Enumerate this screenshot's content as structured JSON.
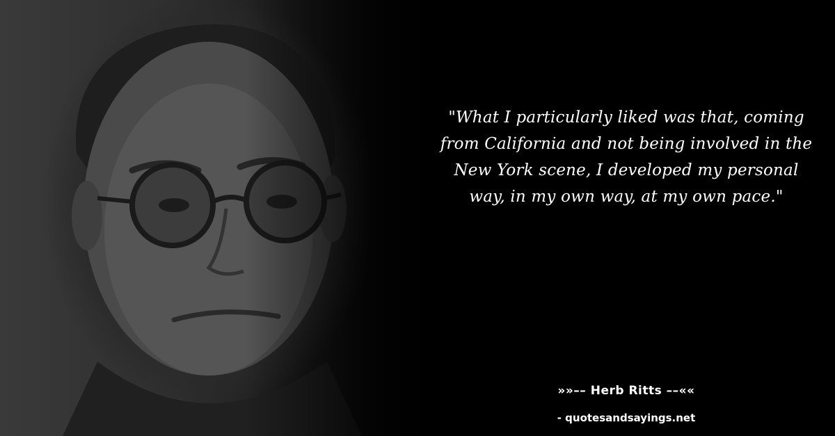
{
  "quote": {
    "text": "\"What I particularly liked was that, coming from California and not being involved in the New York scene, I developed my personal way, in my own way, at my own pace.\""
  },
  "author": {
    "line": "»»–– Herb Ritts ––««"
  },
  "source": {
    "text": "- quotesandsayings.net"
  },
  "colors": {
    "background": "#000000",
    "text": "#ffffff"
  }
}
